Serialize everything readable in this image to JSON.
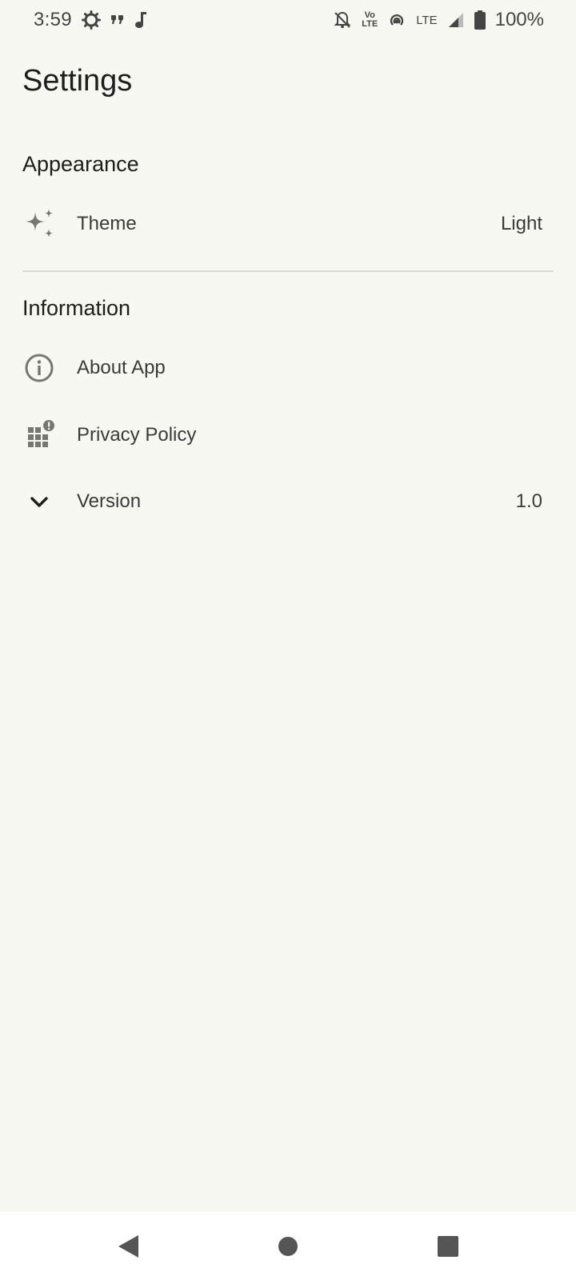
{
  "status_bar": {
    "time": "3:59",
    "network": "LTE",
    "volte_top": "Vo",
    "volte_bottom": "LTE",
    "battery": "100%"
  },
  "title": "Settings",
  "sections": {
    "appearance": {
      "header": "Appearance",
      "theme": {
        "label": "Theme",
        "value": "Light",
        "icon": "sparkle-icon"
      }
    },
    "information": {
      "header": "Information",
      "about": {
        "label": "About App",
        "icon": "info-icon"
      },
      "privacy": {
        "label": "Privacy Policy",
        "icon": "policy-icon"
      },
      "version": {
        "label": "Version",
        "value": "1.0",
        "icon": "chevron-down-icon"
      }
    }
  },
  "colors": {
    "background": "#f8f8f2",
    "icon": "#777772",
    "text": "#1d1d1b"
  }
}
